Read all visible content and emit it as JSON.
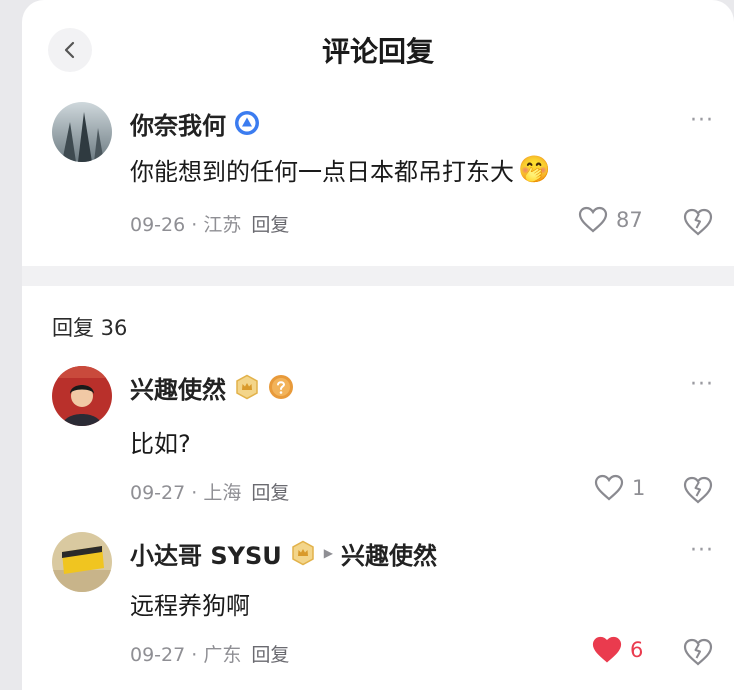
{
  "header": {
    "title": "评论回复"
  },
  "main_comment": {
    "username": "你奈我何",
    "text": "你能想到的任何一点日本都吊打东大",
    "emoji": "🤭",
    "date": "09-26",
    "location": "江苏",
    "reply_label": "回复",
    "likes": "87"
  },
  "replies_header": {
    "label": "回复 36"
  },
  "replies": [
    {
      "username": "兴趣使然",
      "text": "比如?",
      "date": "09-27",
      "location": "上海",
      "reply_label": "回复",
      "likes": "1",
      "liked": false
    },
    {
      "username": "小达哥 SYSU",
      "reply_to": "兴趣使然",
      "text": "远程养狗啊",
      "date": "09-27",
      "location": "广东",
      "reply_label": "回复",
      "likes": "6",
      "liked": true
    }
  ],
  "icons": {
    "back": "chevron-left-icon",
    "more": "more-dots-icon",
    "like": "heart-icon",
    "dislike": "broken-heart-icon",
    "verified": "verified-badge-icon",
    "crown": "crown-badge-icon",
    "question": "question-badge-icon"
  },
  "colors": {
    "liked": "#ea3b4e",
    "verified_badge": "#3b7cf0",
    "crown_badge": "#e2b24a",
    "question_badge": "#e89a3a",
    "meta_text": "#8f8f94"
  },
  "separators": {
    "meta": " · ",
    "more": "···"
  }
}
